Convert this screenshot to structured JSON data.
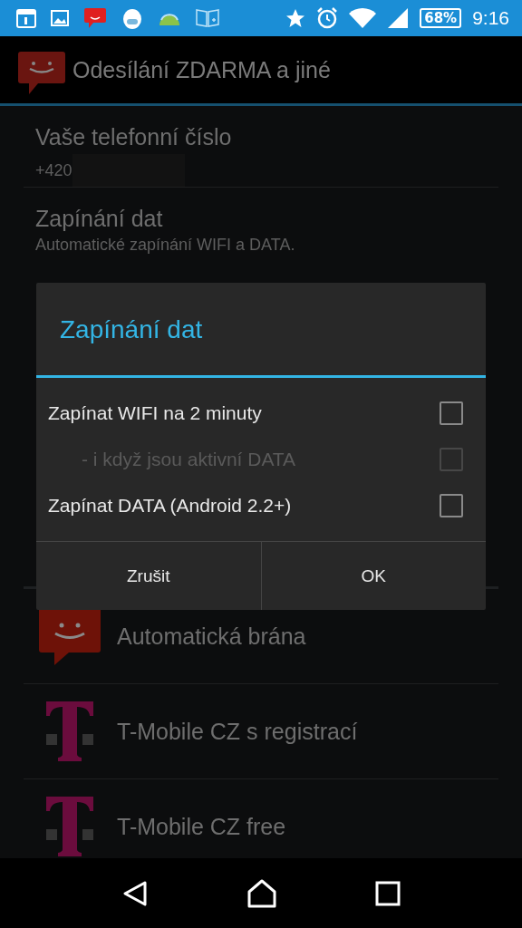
{
  "status_bar": {
    "battery": "68%",
    "time": "9:16"
  },
  "action_bar": {
    "title": "Odesílání ZDARMA a jiné"
  },
  "settings": [
    {
      "title": "Vaše telefonní číslo",
      "summary": "+420"
    },
    {
      "title": "Zapínání dat",
      "summary": "Automatické zapínání WIFI a DATA."
    }
  ],
  "gateways": [
    {
      "label": "Automatická brána",
      "kind": "sms"
    },
    {
      "label": "T-Mobile CZ s registrací",
      "kind": "tmobile"
    },
    {
      "label": "T-Mobile CZ free",
      "kind": "tmobile"
    }
  ],
  "dialog": {
    "title": "Zapínání dat",
    "options": [
      {
        "label": "Zapínat WIFI na 2 minuty",
        "checked": false,
        "disabled": false,
        "kind": "main"
      },
      {
        "label": "- i když jsou aktivní DATA",
        "checked": false,
        "disabled": true,
        "kind": "sub"
      },
      {
        "label": "Zapínat DATA (Android 2.2+)",
        "checked": false,
        "disabled": false,
        "kind": "main"
      }
    ],
    "buttons": [
      "Zrušit",
      "OK"
    ]
  }
}
